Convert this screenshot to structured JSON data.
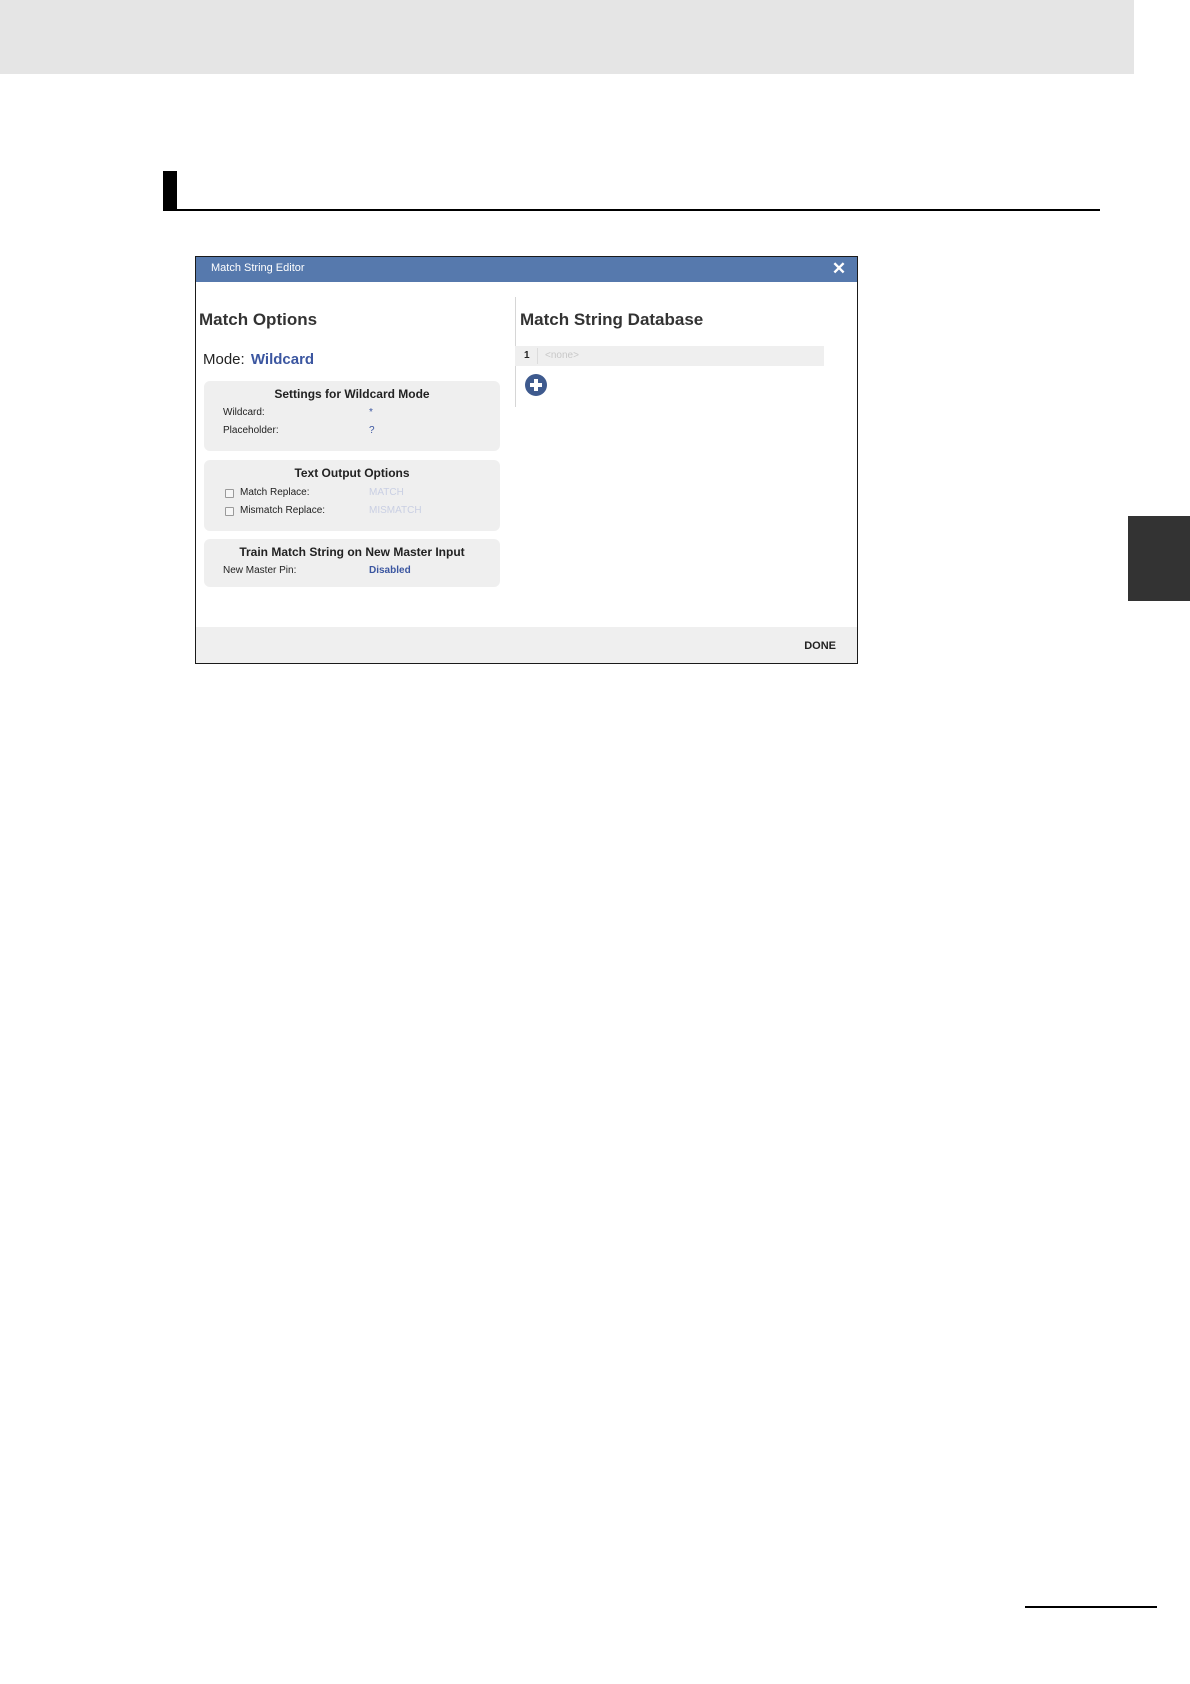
{
  "dialog": {
    "title": "Match String Editor",
    "done_label": "DONE"
  },
  "match_options": {
    "heading": "Match Options",
    "mode_label": "Mode:",
    "mode_value": "Wildcard",
    "wildcard_panel": {
      "title": "Settings for Wildcard Mode",
      "wildcard_label": "Wildcard:",
      "wildcard_value": "*",
      "placeholder_label": "Placeholder:",
      "placeholder_value": "?"
    },
    "text_output_panel": {
      "title": "Text Output Options",
      "match_replace_label": "Match Replace:",
      "match_replace_value": "MATCH",
      "match_replace_checked": false,
      "mismatch_replace_label": "Mismatch Replace:",
      "mismatch_replace_value": "MISMATCH",
      "mismatch_replace_checked": false
    },
    "train_panel": {
      "title": "Train Match String on New Master Input",
      "new_master_pin_label": "New Master Pin:",
      "new_master_pin_value": "Disabled"
    }
  },
  "database": {
    "heading": "Match String Database",
    "rows": [
      {
        "index": "1",
        "value": "<none>"
      }
    ]
  },
  "colors": {
    "titlebar": "#5679ad",
    "accent": "#3b56a0",
    "panel_bg": "#efefef",
    "header_band": "#e5e5e5",
    "side_tab": "#333333"
  },
  "icons": {
    "close": "close-icon",
    "add": "plus-circle-icon"
  }
}
